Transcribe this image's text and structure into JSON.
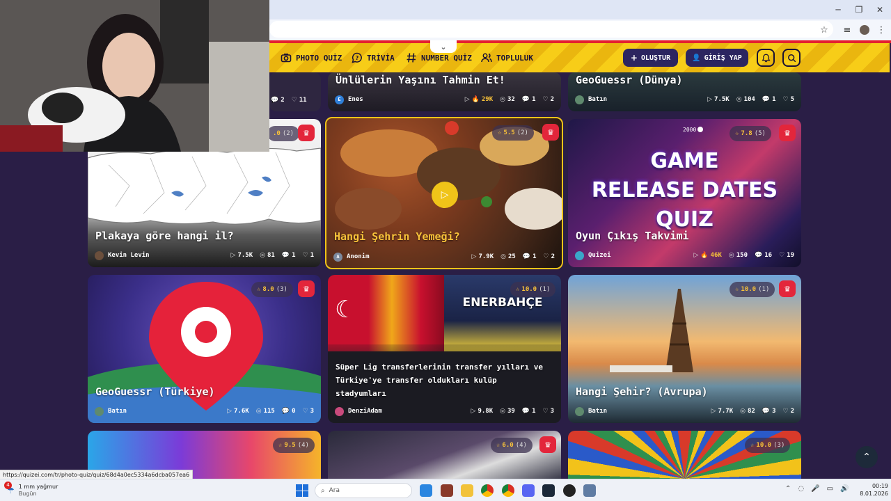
{
  "nav": {
    "items": [
      {
        "label": "PHOTO QUİZ",
        "icon": "camera-icon"
      },
      {
        "label": "TRİVİA",
        "icon": "chat-question-icon"
      },
      {
        "label": "NUMBER QUİZ",
        "icon": "hash-icon"
      },
      {
        "label": "TOPLULUK",
        "icon": "users-icon"
      }
    ],
    "create_label": "OLUŞTUR",
    "login_label": "GİRİŞ YAP"
  },
  "cards": [
    {
      "title": "Ünlülerin Yaşını Tahmin Et!",
      "author": "Enes",
      "author_initial": "E",
      "views": "29K",
      "hot": true,
      "photos": "32",
      "comments": "1",
      "likes": "2"
    },
    {
      "title": "GeoGuessr (Dünya)",
      "author": "Batın",
      "views": "7.5K",
      "photos": "104",
      "comments": "1",
      "likes": "5"
    },
    {
      "partial_stats": {
        "comments": "2",
        "likes": "11"
      }
    },
    {
      "title": "Plakaya göre hangi il?",
      "author": "Kevin Levin",
      "views": "7.5K",
      "photos": "81",
      "comments": "1",
      "likes": "1",
      "rating": ".0",
      "rating_count": "(2)"
    },
    {
      "title": "Hangi Şehrin Yemeği?",
      "author": "Anonim",
      "author_initial": "A",
      "views": "7.9K",
      "photos": "25",
      "comments": "1",
      "likes": "2",
      "rating": "5.5",
      "rating_count": "(2)"
    },
    {
      "title": "Oyun Çıkış Takvimi",
      "author": "Quizei",
      "views": "46K",
      "hot": true,
      "photos": "150",
      "comments": "16",
      "likes": "19",
      "rating": "7.8",
      "rating_count": "(5)",
      "image_text": [
        "GAME",
        "RELEASE DATES",
        "QUIZ"
      ],
      "slider_label": "2000"
    },
    {
      "title": "GeoGuessr (Türkiye)",
      "author": "Batın",
      "views": "7.6K",
      "photos": "115",
      "comments": "0",
      "likes": "3",
      "rating": "8.0",
      "rating_count": "(3)"
    },
    {
      "title": "Süper Lig transferlerinin transfer yılları ve Türkiye'ye transfer oldukları kulüp stadyumları",
      "author": "DenziAdam",
      "views": "9.8K",
      "photos": "39",
      "comments": "1",
      "likes": "3",
      "rating": "10.0",
      "rating_count": "(1)",
      "image_text": "ENERBAHÇE"
    },
    {
      "title": "Hangi Şehir? (Avrupa)",
      "author": "Batın",
      "views": "7.7K",
      "photos": "82",
      "comments": "3",
      "likes": "2",
      "rating": "10.0",
      "rating_count": "(1)"
    },
    {
      "rating": "9.5",
      "rating_count": "(4)"
    },
    {
      "rating": "6.0",
      "rating_count": "(4)"
    },
    {
      "rating": "10.0",
      "rating_count": "(3)"
    }
  ],
  "status_url": "https://quizei.com/tr/photo-quiz/quiz/68d4a0ec5334a6dcba057ea6",
  "taskbar": {
    "weather_temp": "1 mm yağmur",
    "weather_sub": "Bugün",
    "weather_badge": "4",
    "search_placeholder": "Ara",
    "time": "00:19",
    "date": "8.01.2026"
  },
  "colors": {
    "nav_yellow": "#f7cd18",
    "nav_dark": "#2c2560",
    "crown_red": "#e3263b",
    "rating_gold": "#f8c23a",
    "bg": "#2a1e46"
  }
}
